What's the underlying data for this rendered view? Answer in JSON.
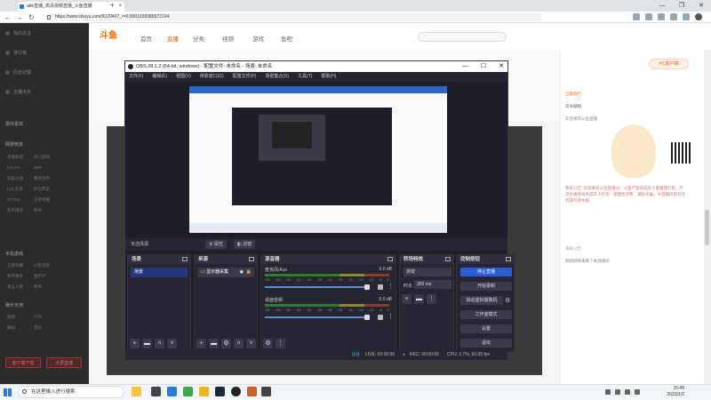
{
  "browser": {
    "tab_title": "attk直播_高清视频直播_斗鱼直播",
    "url": "https://www.douyu.com/9170407_r=0.9001939386572104",
    "window_controls": [
      "—",
      "❐",
      "✕"
    ]
  },
  "site": {
    "logo": "斗鱼",
    "nav": [
      "首页",
      "直播",
      "分类",
      "视频",
      "游戏",
      "鱼吧"
    ],
    "search_placeholder": "",
    "pc_button": "PC客户端"
  },
  "sidebar": {
    "top_items": [
      "我的关注",
      "排行榜",
      "历史记录",
      "主播卡片"
    ],
    "sections": [
      {
        "title": "猜你喜欢",
        "subs": []
      },
      {
        "title": "网游竞技",
        "subs": [
          "英雄联盟",
          "热门游戏",
          "CS:GO",
          "DNF",
          "穿越火线",
          "魔兽世界",
          "LOL云顶",
          "炉石传说",
          "DOTA2",
          "王者荣耀",
          "和平精英",
          "原神"
        ]
      },
      {
        "title": "手机游戏",
        "subs": [
          "王者荣耀",
          "火影忍者",
          "和平精英",
          "金铲铲",
          "第五人格",
          "原神"
        ]
      },
      {
        "title": "娱乐天地",
        "subs": [
          "颜值",
          "户外",
          "舞蹈",
          "音乐"
        ]
      }
    ],
    "bottom_buttons": [
      "客户端下载",
      "大屏直播"
    ]
  },
  "right_panel": {
    "lines": [
      "全部排行",
      "日贡献榜",
      "欢迎来到斗鱼直播",
      "系统公告",
      "刚刚刚刚来来了本直播间"
    ],
    "notice": "系统公告: 欢迎来到斗鱼直播间，斗鱼严禁未成年人直播或打赏，严禁主播诱导未成年人打赏，请理性消费，谨防诈骗，对直播内容有任何疑问请举报。"
  },
  "obs": {
    "title": "OBS 28.1.2 (64-bit, windows) - 配置文件: 未命名 - 场景: 未命名",
    "menu": [
      "文件(F)",
      "编辑(E)",
      "视图(V)",
      "停靠窗口(D)",
      "配置文件(P)",
      "场景集合(S)",
      "工具(T)",
      "帮助(H)"
    ],
    "no_source": "未选择源",
    "ctx_buttons": [
      "⚙ 属性",
      "◧ 滤镜"
    ],
    "docks": {
      "scenes": {
        "title": "场景",
        "items": [
          "场景"
        ]
      },
      "sources": {
        "title": "来源",
        "items": [
          "显示器采集"
        ]
      },
      "mixer": {
        "title": "混音器",
        "channels": [
          {
            "name": "麦克风/Aux",
            "db": "0.0 dB"
          },
          {
            "name": "桌面音频",
            "db": "0.0 dB"
          }
        ],
        "scale": [
          "-60",
          "-55",
          "-50",
          "-45",
          "-40",
          "-35",
          "-30",
          "-25",
          "-20",
          "-15",
          "-10",
          "-5",
          "0"
        ]
      },
      "transitions": {
        "title": "转场特效",
        "type": "渐变",
        "duration_label": "时长",
        "duration": "300 ms"
      },
      "controls": {
        "title": "控制按钮",
        "buttons": [
          "停止直播",
          "开始录制",
          "启动虚拟摄像机",
          "工作室模式",
          "设置",
          "退出"
        ]
      }
    },
    "status": {
      "live": "LIVE: 00:00:00",
      "rec": "REC: 00:00:00",
      "cpu": "CPU: 2.7%, 60.00 fps"
    }
  },
  "taskbar": {
    "search_text": "在这里输入进行搜索",
    "time": "15:49",
    "date": "2023/1/2"
  }
}
